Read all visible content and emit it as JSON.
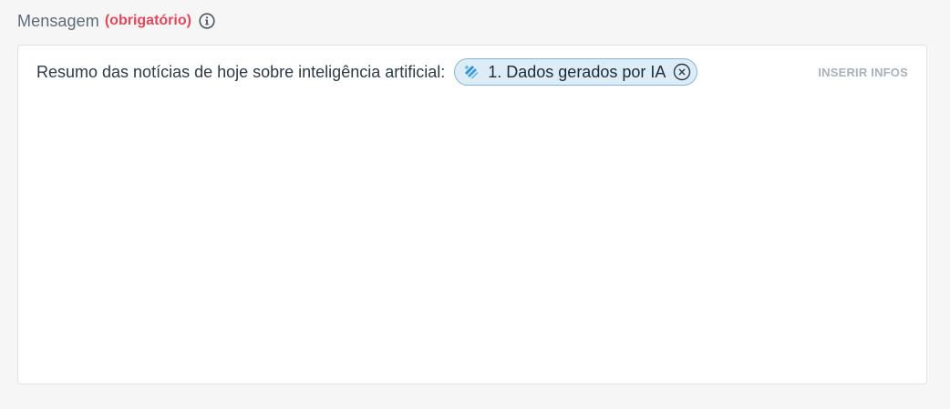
{
  "field": {
    "label": "Mensagem",
    "required_tag": "(obrigatório)",
    "info_icon": "info-icon"
  },
  "editor": {
    "text": "Resumo das notícias de hoje sobre inteligência artificial:",
    "chip": {
      "icon": "ai-sparkle-icon",
      "label": "1. Dados gerados por IA",
      "close_icon": "close-circle-icon"
    },
    "insert_label": "INSERIR INFOS"
  },
  "colors": {
    "required": "#e2475c",
    "chip_bg": "#dcedf8",
    "chip_border": "#8ab3d3",
    "chip_icon": "#2a8fd6",
    "muted": "#a9b1ba"
  }
}
